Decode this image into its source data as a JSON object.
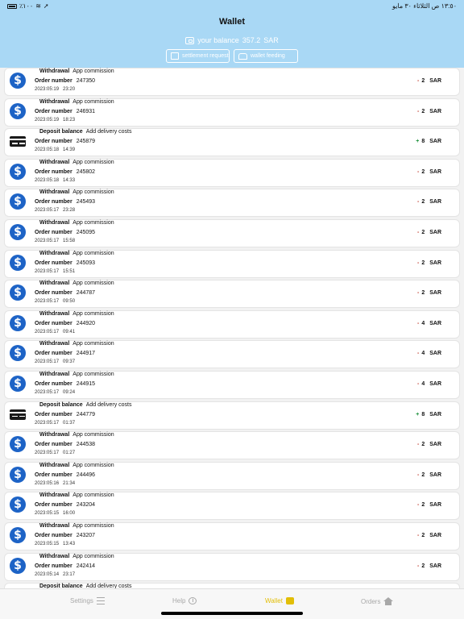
{
  "status_bar": {
    "left": "٪١٠٠",
    "right": "١٣:٥٠ ص   الثلاثاء ٣٠ مايو"
  },
  "header": {
    "title": "Wallet",
    "balance_label": "your balance",
    "balance_amount": "357.2",
    "balance_currency": "SAR",
    "settlement_label": "settlement request",
    "feeding_label": "wallet feeding"
  },
  "transactions": [
    {
      "icon": "dollar-icon",
      "type": "Withdrawal",
      "desc": "App commission",
      "order_label": "Order number",
      "order": "247350",
      "date": "2023:05:19",
      "time": "23:20",
      "sign": "-",
      "amount": "2",
      "currency": "SAR"
    },
    {
      "icon": "dollar-icon",
      "type": "Withdrawal",
      "desc": "App commission",
      "order_label": "Order number",
      "order": "246931",
      "date": "2023:05:19",
      "time": "18:23",
      "sign": "-",
      "amount": "2",
      "currency": "SAR"
    },
    {
      "icon": "card-icon",
      "type": "Deposit balance",
      "desc": "Add delivery costs",
      "order_label": "Order number",
      "order": "245879",
      "date": "2023:05:18",
      "time": "14:39",
      "sign": "+",
      "amount": "8",
      "currency": "SAR"
    },
    {
      "icon": "dollar-icon",
      "type": "Withdrawal",
      "desc": "App commission",
      "order_label": "Order number",
      "order": "245802",
      "date": "2023:05:18",
      "time": "14:33",
      "sign": "-",
      "amount": "2",
      "currency": "SAR"
    },
    {
      "icon": "dollar-icon",
      "type": "Withdrawal",
      "desc": "App commission",
      "order_label": "Order number",
      "order": "245493",
      "date": "2023:05:17",
      "time": "23:28",
      "sign": "-",
      "amount": "2",
      "currency": "SAR"
    },
    {
      "icon": "dollar-icon",
      "type": "Withdrawal",
      "desc": "App commission",
      "order_label": "Order number",
      "order": "245095",
      "date": "2023:05:17",
      "time": "15:58",
      "sign": "-",
      "amount": "2",
      "currency": "SAR"
    },
    {
      "icon": "dollar-icon",
      "type": "Withdrawal",
      "desc": "App commission",
      "order_label": "Order number",
      "order": "245093",
      "date": "2023:05:17",
      "time": "15:51",
      "sign": "-",
      "amount": "2",
      "currency": "SAR"
    },
    {
      "icon": "dollar-icon",
      "type": "Withdrawal",
      "desc": "App commission",
      "order_label": "Order number",
      "order": "244787",
      "date": "2023:05:17",
      "time": "09:50",
      "sign": "-",
      "amount": "2",
      "currency": "SAR"
    },
    {
      "icon": "dollar-icon",
      "type": "Withdrawal",
      "desc": "App commission",
      "order_label": "Order number",
      "order": "244920",
      "date": "2023:05:17",
      "time": "09:41",
      "sign": "-",
      "amount": "4",
      "currency": "SAR"
    },
    {
      "icon": "dollar-icon",
      "type": "Withdrawal",
      "desc": "App commission",
      "order_label": "Order number",
      "order": "244917",
      "date": "2023:05:17",
      "time": "09:37",
      "sign": "-",
      "amount": "4",
      "currency": "SAR"
    },
    {
      "icon": "dollar-icon",
      "type": "Withdrawal",
      "desc": "App commission",
      "order_label": "Order number",
      "order": "244915",
      "date": "2023:05:17",
      "time": "09:24",
      "sign": "-",
      "amount": "4",
      "currency": "SAR"
    },
    {
      "icon": "card-icon",
      "type": "Deposit balance",
      "desc": "Add delivery costs",
      "order_label": "Order number",
      "order": "244779",
      "date": "2023:05:17",
      "time": "01:37",
      "sign": "+",
      "amount": "8",
      "currency": "SAR"
    },
    {
      "icon": "dollar-icon",
      "type": "Withdrawal",
      "desc": "App commission",
      "order_label": "Order number",
      "order": "244538",
      "date": "2023:05:17",
      "time": "01:27",
      "sign": "-",
      "amount": "2",
      "currency": "SAR"
    },
    {
      "icon": "dollar-icon",
      "type": "Withdrawal",
      "desc": "App commission",
      "order_label": "Order number",
      "order": "244496",
      "date": "2023:05:16",
      "time": "21:34",
      "sign": "-",
      "amount": "2",
      "currency": "SAR"
    },
    {
      "icon": "dollar-icon",
      "type": "Withdrawal",
      "desc": "App commission",
      "order_label": "Order number",
      "order": "243204",
      "date": "2023:05:15",
      "time": "16:00",
      "sign": "-",
      "amount": "2",
      "currency": "SAR"
    },
    {
      "icon": "dollar-icon",
      "type": "Withdrawal",
      "desc": "App commission",
      "order_label": "Order number",
      "order": "243207",
      "date": "2023:05:15",
      "time": "13:43",
      "sign": "-",
      "amount": "2",
      "currency": "SAR"
    },
    {
      "icon": "dollar-icon",
      "type": "Withdrawal",
      "desc": "App commission",
      "order_label": "Order number",
      "order": "242414",
      "date": "2023:05:14",
      "time": "23:17",
      "sign": "-",
      "amount": "2",
      "currency": "SAR"
    },
    {
      "icon": "card-icon",
      "type": "Deposit balance",
      "desc": "Add delivery costs",
      "order_label": "",
      "order": "",
      "date": "",
      "time": "",
      "sign": "",
      "amount": "",
      "currency": ""
    }
  ],
  "tabs": {
    "settings": "Settings",
    "help": "Help",
    "wallet": "Wallet",
    "orders": "Orders",
    "active_color": "#e2be07"
  },
  "colors": {
    "header_bg": "#a9d8f5",
    "dollar_icon": "#1d63c6",
    "negative": "#c0392b",
    "positive": "#1a8f3a"
  }
}
